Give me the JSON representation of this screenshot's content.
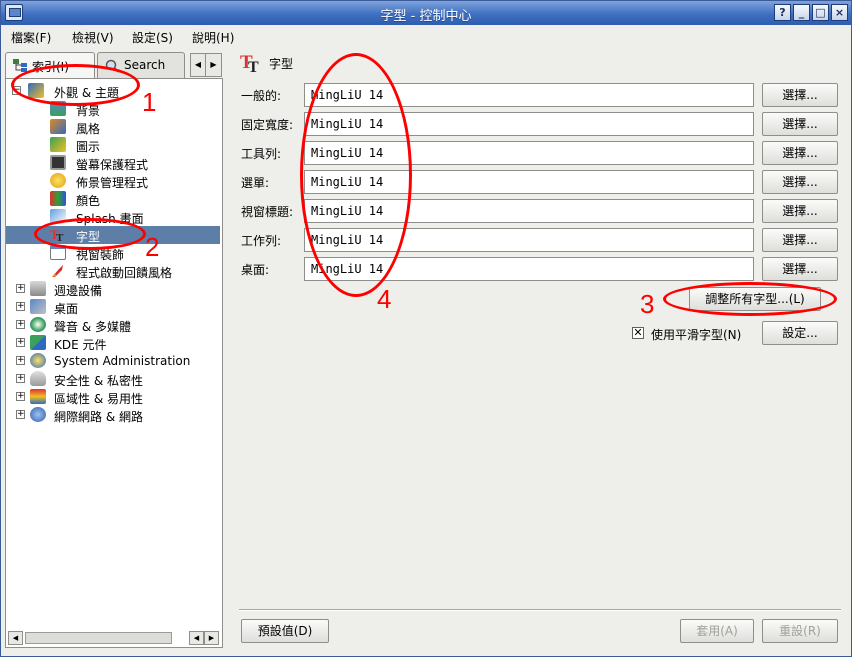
{
  "window": {
    "title": "字型 - 控制中心",
    "buttons": [
      "?",
      "_",
      "□",
      "×"
    ]
  },
  "menubar": {
    "items": [
      "檔案(F)",
      "檢視(V)",
      "設定(S)",
      "說明(H)"
    ]
  },
  "sidebar": {
    "tabs": [
      {
        "label": "索引(I)",
        "icon": "index-tree-icon"
      },
      {
        "label": "Search",
        "icon": "magnifier-icon"
      }
    ],
    "tab_scroll": [
      "◀",
      "▶"
    ],
    "tree": [
      {
        "label": "外觀 & 主題",
        "expander": "−",
        "icon": "appearance-icon"
      },
      {
        "label": "背景",
        "icon": "background-icon"
      },
      {
        "label": "風格",
        "icon": "style-icon"
      },
      {
        "label": "圖示",
        "icon": "icons-icon"
      },
      {
        "label": "螢幕保護程式",
        "icon": "screensaver-icon"
      },
      {
        "label": "佈景管理程式",
        "icon": "theme-manager-icon"
      },
      {
        "label": "顏色",
        "icon": "colors-icon"
      },
      {
        "label": "Splash 畫面",
        "icon": "splash-icon"
      },
      {
        "label": "字型",
        "icon": "fonts-icon",
        "selected": true
      },
      {
        "label": "視窗裝飾",
        "icon": "window-decoration-icon"
      },
      {
        "label": "程式啟動回饋風格",
        "icon": "launch-feedback-icon"
      },
      {
        "label": "週邊設備",
        "expander": "+",
        "icon": "peripherals-icon"
      },
      {
        "label": "桌面",
        "expander": "+",
        "icon": "desktop-icon"
      },
      {
        "label": "聲音 & 多媒體",
        "expander": "+",
        "icon": "sound-icon"
      },
      {
        "label": "KDE 元件",
        "expander": "+",
        "icon": "kde-components-icon"
      },
      {
        "label": "System Administration",
        "expander": "+",
        "icon": "sysadmin-icon"
      },
      {
        "label": "安全性 & 私密性",
        "expander": "+",
        "icon": "security-icon"
      },
      {
        "label": "區域性 & 易用性",
        "expander": "+",
        "icon": "regional-icon"
      },
      {
        "label": "網際網路 & 網路",
        "expander": "+",
        "icon": "internet-icon"
      }
    ],
    "hscroll": [
      "◀",
      "▶",
      "◀",
      "▶"
    ]
  },
  "module": {
    "title": "字型",
    "icon": "fonts-tt-icon",
    "rows": [
      {
        "label": "一般的:",
        "value": "MingLiU 14",
        "button": "選擇..."
      },
      {
        "label": "固定寬度:",
        "value": "MingLiU 14",
        "button": "選擇..."
      },
      {
        "label": "工具列:",
        "value": "MingLiU 14",
        "button": "選擇..."
      },
      {
        "label": "選單:",
        "value": "MingLiU 14",
        "button": "選擇..."
      },
      {
        "label": "視窗標題:",
        "value": "MingLiU 14",
        "button": "選擇..."
      },
      {
        "label": "工作列:",
        "value": "MingLiU 14",
        "button": "選擇..."
      },
      {
        "label": "桌面:",
        "value": "MingLiU 14",
        "button": "選擇..."
      }
    ],
    "adjust_all": "調整所有字型...(L)",
    "antialias": {
      "label": "使用平滑字型(N)",
      "checked": true,
      "check_glyph": "✕"
    },
    "settings_button": "設定..."
  },
  "footer": {
    "defaults": "預設值(D)",
    "apply": "套用(A)",
    "reset": "重設(R)"
  },
  "annotations": [
    "1",
    "2",
    "3",
    "4"
  ],
  "colors": {
    "annotation": "#ff0000",
    "selection": "#5d7ea6",
    "titlebar": "#3f6fc0"
  }
}
